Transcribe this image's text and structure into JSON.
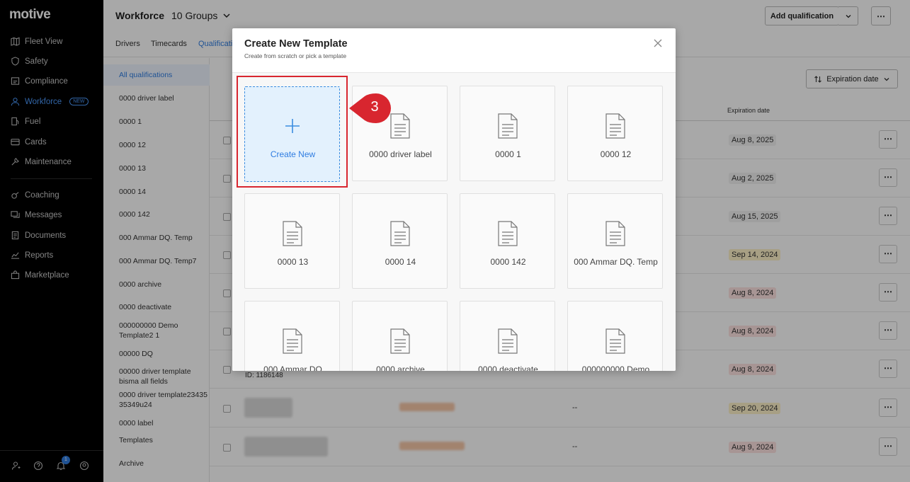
{
  "nav": {
    "logo": "motive",
    "items": [
      {
        "label": "Fleet View",
        "icon": "map-icon"
      },
      {
        "label": "Safety",
        "icon": "shield-icon"
      },
      {
        "label": "Compliance",
        "icon": "compliance-icon"
      },
      {
        "label": "Workforce",
        "icon": "person-icon",
        "badge": "NEW"
      },
      {
        "label": "Fuel",
        "icon": "fuel-icon"
      },
      {
        "label": "Cards",
        "icon": "card-icon"
      },
      {
        "label": "Maintenance",
        "icon": "wrench-icon"
      },
      {
        "label": "Coaching",
        "icon": "whistle-icon"
      },
      {
        "label": "Messages",
        "icon": "messages-icon"
      },
      {
        "label": "Documents",
        "icon": "document-icon"
      },
      {
        "label": "Reports",
        "icon": "chart-icon"
      },
      {
        "label": "Marketplace",
        "icon": "bag-icon"
      }
    ],
    "notification_count": "1"
  },
  "header": {
    "title": "Workforce",
    "groups": "10 Groups",
    "add_button": "Add qualification"
  },
  "tabs": [
    "Drivers",
    "Timecards",
    "Qualificati"
  ],
  "subnav": {
    "items": [
      "All qualifications",
      "0000 driver label",
      "0000 1",
      "0000 12",
      "0000 13",
      "0000 14",
      "0000 142",
      "000 Ammar DQ. Temp",
      "000 Ammar DQ. Temp7",
      "0000 archive",
      "0000 deactivate",
      "000000000 Demo Template2 1",
      "00000 DQ",
      "00000 driver template bisma all fields",
      "0000 driver template2343535349u24",
      "0000 label",
      "Templates",
      "Archive"
    ]
  },
  "table": {
    "sort_label": "Expiration date",
    "header_expiration": "Expiration date",
    "id_text": "ID: 1186148",
    "dash": "--",
    "dates": [
      {
        "text": "Aug 8, 2025",
        "status": "normal"
      },
      {
        "text": "Aug 2, 2025",
        "status": "normal"
      },
      {
        "text": "Aug 15, 2025",
        "status": "normal"
      },
      {
        "text": "Sep 14, 2024",
        "status": "warn"
      },
      {
        "text": "Aug 8, 2024",
        "status": "bad"
      },
      {
        "text": "Aug 8, 2024",
        "status": "bad"
      },
      {
        "text": "Aug 8, 2024",
        "status": "bad"
      },
      {
        "text": "Sep 20, 2024",
        "status": "warn"
      },
      {
        "text": "Aug 9, 2024",
        "status": "bad"
      }
    ]
  },
  "modal": {
    "title": "Create New Template",
    "subtitle": "Create from scratch or pick a template",
    "create_label": "Create New",
    "templates": [
      "0000 driver label",
      "0000 1",
      "0000 12",
      "0000 13",
      "0000 14",
      "0000 142",
      "000 Ammar DQ. Temp",
      "000 Ammar DQ",
      "0000 archive",
      "0000 deactivate",
      "000000000 Demo"
    ]
  },
  "annotation": {
    "step": "3",
    "color": "#d8262f"
  },
  "colors": {
    "accent": "#2f7de1",
    "nav_bg": "#000000"
  }
}
